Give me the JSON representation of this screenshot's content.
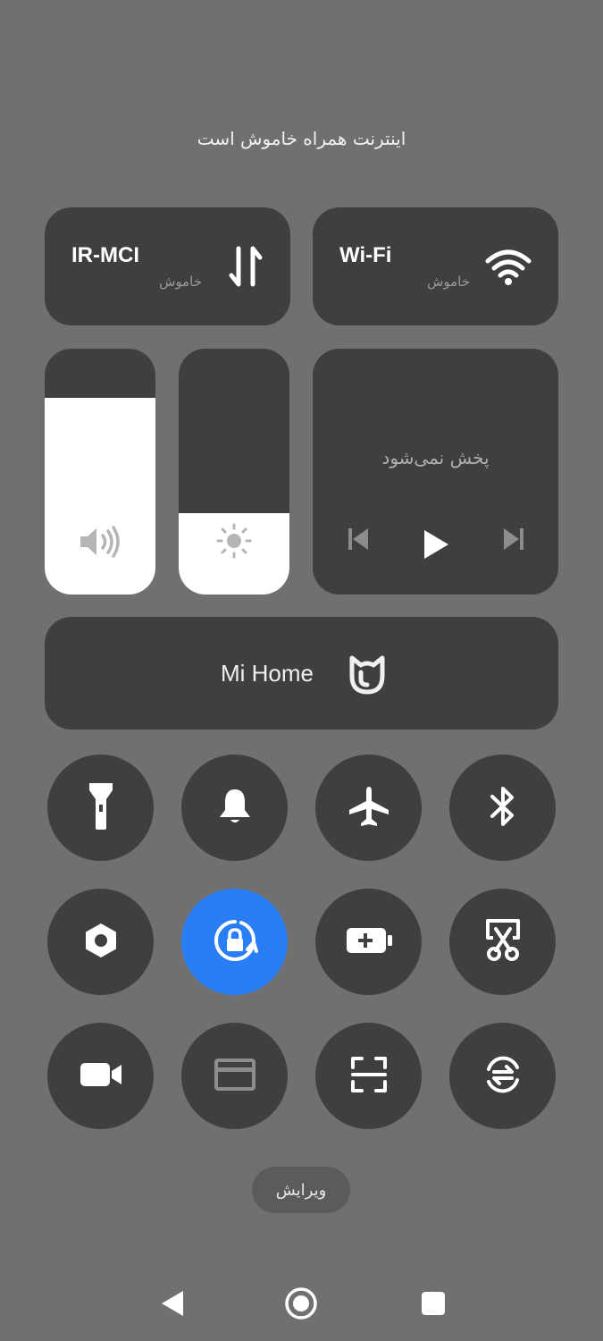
{
  "status_message": "اینترنت همراه خاموش است",
  "network": {
    "mobile": {
      "title": "IR-MCI",
      "state": "خاموش",
      "icon": "mobile-data-icon"
    },
    "wifi": {
      "title": "Wi-Fi",
      "state": "خاموش",
      "icon": "wifi-icon"
    }
  },
  "sliders": {
    "volume": {
      "level": 0.8,
      "icon": "volume-icon"
    },
    "brightness": {
      "level": 0.33,
      "icon": "brightness-icon"
    }
  },
  "media": {
    "status": "پخش نمی‌شود",
    "controls": [
      "previous-icon",
      "play-icon",
      "next-icon"
    ]
  },
  "mi_home": {
    "label": "Mi Home",
    "icon": "mi-home-icon"
  },
  "toggles": [
    {
      "name": "flashlight",
      "icon": "flashlight-icon",
      "active": false
    },
    {
      "name": "silent",
      "icon": "bell-icon",
      "active": false
    },
    {
      "name": "airplane-mode",
      "icon": "airplane-icon",
      "active": false
    },
    {
      "name": "bluetooth",
      "icon": "bluetooth-icon",
      "active": false
    },
    {
      "name": "settings",
      "icon": "hexagon-settings-icon",
      "active": false
    },
    {
      "name": "rotation-lock",
      "icon": "rotation-lock-icon",
      "active": true
    },
    {
      "name": "battery-saver",
      "icon": "battery-saver-icon",
      "active": false
    },
    {
      "name": "screenshot",
      "icon": "scissors-screenshot-icon",
      "active": false
    },
    {
      "name": "screen-recorder",
      "icon": "video-camera-icon",
      "active": false
    },
    {
      "name": "floating-window",
      "icon": "window-card-icon",
      "active": false
    },
    {
      "name": "scanner",
      "icon": "scan-icon",
      "active": false
    },
    {
      "name": "sync",
      "icon": "sync-icon",
      "active": false
    }
  ],
  "edit_label": "ویرایش",
  "colors": {
    "background": "#707070",
    "tile": "#3f3f3f",
    "accent": "#2a7ef5"
  },
  "nav": [
    "back-icon",
    "home-icon",
    "recents-icon"
  ]
}
